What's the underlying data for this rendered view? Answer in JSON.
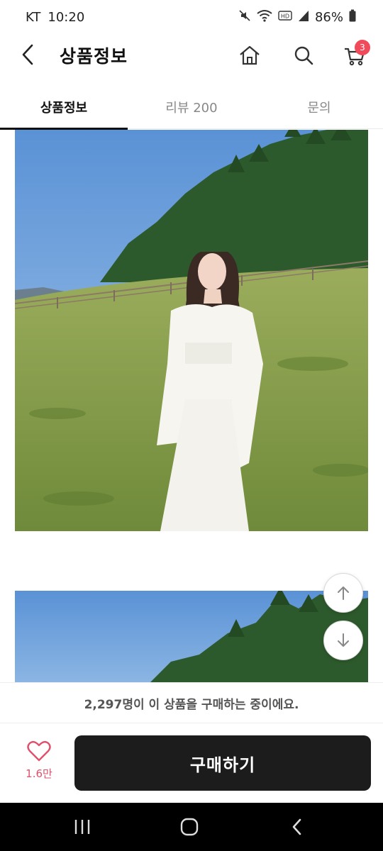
{
  "status_bar": {
    "carrier": "KT",
    "time": "10:20",
    "battery": "86%"
  },
  "header": {
    "title": "상품정보",
    "cart_count": "3"
  },
  "tabs": [
    {
      "label": "상품정보",
      "active": true
    },
    {
      "label": "리뷰 200",
      "active": false
    },
    {
      "label": "문의",
      "active": false
    }
  ],
  "notice": {
    "text": "2,297명이 이 상품을 구매하는 중이에요."
  },
  "actions": {
    "like_count": "1.6만",
    "buy_label": "구매하기"
  },
  "colors": {
    "accent": "#ef4b5a",
    "heart": "#e0506b",
    "buy_button": "#1c1c1c"
  }
}
